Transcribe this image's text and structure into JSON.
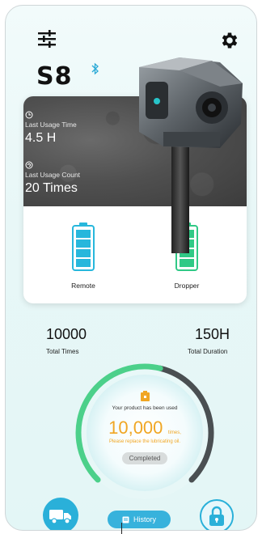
{
  "header": {
    "model_name": "S8",
    "settings_icon": "sliders-icon",
    "gear_icon": "gear-icon",
    "bluetooth_icon": "bluetooth-icon"
  },
  "usage": {
    "last_time_label": "Last Usage Time",
    "last_time_value": "4.5 H",
    "last_count_label": "Last Usage Count",
    "last_count_value": "20 Times"
  },
  "batteries": [
    {
      "label": "Remote",
      "level": 1.0
    },
    {
      "label": "Dropper",
      "level": 1.0
    }
  ],
  "stats": {
    "total_times_value": "10000",
    "total_times_label": "Total Times",
    "total_duration_value": "150H",
    "total_duration_label": "Total Duration"
  },
  "gauge": {
    "used_text": "Your product has been used",
    "count": "10,000",
    "unit": "times,",
    "replace_text": "Please replace the lubricating oil.",
    "completed_label": "Completed",
    "progress": 0.55,
    "colors": {
      "progress": "#4cd08a",
      "track": "#4a4f52",
      "accent": "#f0a623"
    }
  },
  "bottom": {
    "history_label": "History",
    "truck_icon": "truck-icon",
    "lock_icon": "lock-icon",
    "accent": "#2ab0d9"
  }
}
